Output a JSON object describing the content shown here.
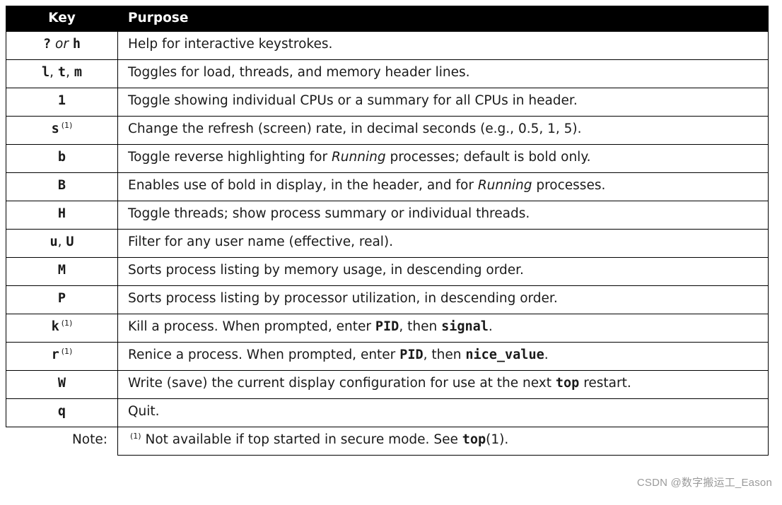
{
  "header": {
    "key": "Key",
    "purpose": "Purpose"
  },
  "rows": [
    {
      "key_html": "<span class='mono'>?</span> <span class='plain'>or</span> <span class='mono'>h</span>",
      "purpose_html": "Help for interactive keystrokes."
    },
    {
      "key_html": "<span class='mono'>l</span><span class='sep'>, </span><span class='mono'>t</span><span class='sep'>, </span><span class='mono'>m</span>",
      "purpose_html": "Toggles for load, threads, and memory header lines."
    },
    {
      "key_html": "<span class='mono'>1</span>",
      "purpose_html": "Toggle showing individual CPUs or a summary for all CPUs in header."
    },
    {
      "key_html": "<span class='mono'>s</span><sup class='note-ref'>(1)</sup>",
      "purpose_html": "Change the refresh (screen) rate, in decimal seconds (e.g., 0.5, 1, 5)."
    },
    {
      "key_html": "<span class='mono'>b</span>",
      "purpose_html": "Toggle reverse highlighting for <em class='run'>Running</em> processes; default is bold only."
    },
    {
      "key_html": "<span class='mono'>B</span>",
      "purpose_html": "Enables use of bold in display, in the header, and for <em class='run'>Running</em> processes."
    },
    {
      "key_html": "<span class='mono'>H</span>",
      "purpose_html": "Toggle threads; show process summary or individual threads."
    },
    {
      "key_html": "<span class='mono'>u</span><span class='sep'>, </span><span class='mono'>U</span>",
      "purpose_html": "Filter for any user name (effective, real)."
    },
    {
      "key_html": "<span class='mono'>M</span>",
      "purpose_html": "Sorts process listing by memory usage, in descending order."
    },
    {
      "key_html": "<span class='mono'>P</span>",
      "purpose_html": "Sorts process listing by processor utilization, in descending order."
    },
    {
      "key_html": "<span class='mono'>k</span><sup class='note-ref'>(1)</sup>",
      "purpose_html": "Kill a process. When prompted, enter <span class='mono'>PID</span>, then <span class='mono'>signal</span>."
    },
    {
      "key_html": "<span class='mono'>r</span><sup class='note-ref'>(1)</sup>",
      "purpose_html": "Renice a process. When prompted, enter <span class='mono'>PID</span>, then <span class='mono'>nice_value</span>."
    },
    {
      "key_html": "<span class='mono'>W</span>",
      "purpose_html": "Write (save) the current display configuration for use at the next <span class='mono'>top</span> restart."
    },
    {
      "key_html": "<span class='mono'>q</span>",
      "purpose_html": "Quit."
    }
  ],
  "note": {
    "label": "Note:",
    "body_html": "<sup class='note-ref'>(1)</sup> Not available if top started in secure mode. See <span class='mono'>top</span>(1)."
  },
  "watermark": "CSDN @数字搬运工_Eason"
}
